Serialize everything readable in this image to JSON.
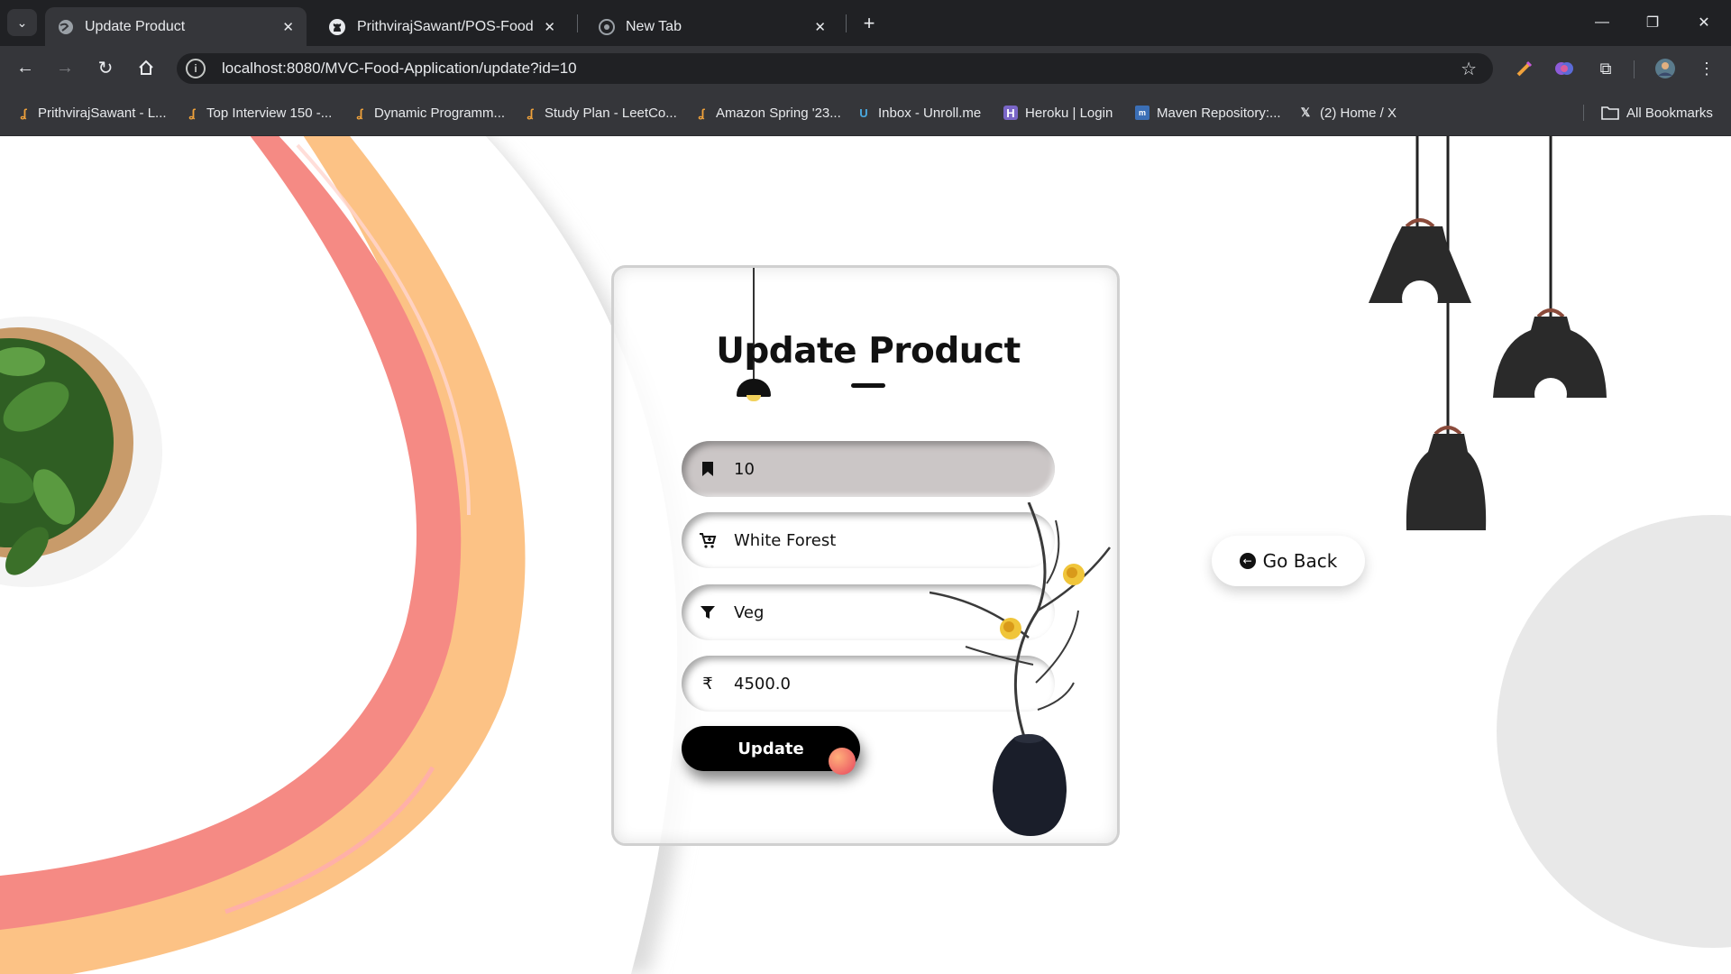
{
  "browser": {
    "tabs": [
      {
        "title": "Update Product",
        "active": true,
        "icon": "globe-icon"
      },
      {
        "title": "PrithvirajSawant/POS-Food-Ord",
        "active": false,
        "icon": "github-icon"
      },
      {
        "title": "New Tab",
        "active": false,
        "icon": "chrome-icon"
      }
    ],
    "url": "localhost:8080/MVC-Food-Application/update?id=10",
    "bookmarks": [
      {
        "label": "PrithvirajSawant - L...",
        "icon": "leetcode-icon"
      },
      {
        "label": "Top Interview 150 -...",
        "icon": "leetcode-icon"
      },
      {
        "label": "Dynamic Programm...",
        "icon": "leetcode-icon"
      },
      {
        "label": "Study Plan - LeetCo...",
        "icon": "leetcode-icon"
      },
      {
        "label": "Amazon Spring '23...",
        "icon": "leetcode-icon"
      },
      {
        "label": "Inbox - Unroll.me",
        "icon": "unroll-icon"
      },
      {
        "label": "Heroku | Login",
        "icon": "heroku-icon"
      },
      {
        "label": "Maven Repository:...",
        "icon": "maven-icon"
      },
      {
        "label": "(2) Home / X",
        "icon": "x-icon"
      }
    ],
    "all_bookmarks": "All Bookmarks"
  },
  "form": {
    "title": "Update Product",
    "fields": [
      {
        "name": "id",
        "value": "10",
        "icon": "bookmark-icon",
        "readonly": true
      },
      {
        "name": "product-name",
        "value": "White Forest",
        "icon": "cart-plus-icon"
      },
      {
        "name": "category",
        "value": "Veg",
        "icon": "filter-icon"
      },
      {
        "name": "price",
        "value": "4500.0",
        "icon": "rupee-icon",
        "icon_glyph": "₹"
      }
    ],
    "submit_label": "Update"
  },
  "go_back_label": "Go Back",
  "colors": {
    "button": "#000000",
    "readonly_field": "#cbc6c6",
    "brush_pink": "#f58a84",
    "brush_orange": "#fcc285"
  }
}
